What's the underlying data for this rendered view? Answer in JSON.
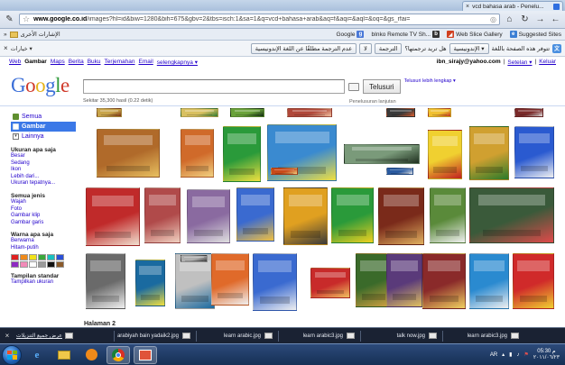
{
  "browser": {
    "tab_title": "vcd bahasa arab - Penelu...",
    "url_host": "www.google.co.id",
    "url_rest": "/images?hl=id&biw=1280&bih=675&gbv=2&tbs=isch:1&sa=1&q=vcd+bahasa+arab&aq=f&aqi=&aql=&oq=&gs_rfai=",
    "bookmarks_folder": "الإشارات الأخرى",
    "bookmarks": [
      "Google",
      "bInko Remote TV Sh...",
      "Web Slice Gallery",
      "Suggested Sites"
    ]
  },
  "translate_bar": {
    "options": "خيارات",
    "question": "هل تريد ترجمتها؟",
    "from_lang": "الإندونيسية",
    "prompt": "تتوفر هذه الصفحة باللغة",
    "translate_btn": "الترجمة",
    "close_btn": "لا",
    "never_btn": "عدم الترجمة مطلقًا عن اللغة الإندونيسية"
  },
  "gbar": {
    "links": [
      "Web",
      "Gambar",
      "Maps",
      "Berita",
      "Buku",
      "Terjemahan",
      "Email",
      "selengkapnya ▾"
    ],
    "active_index": 1,
    "user": "ibn_sirajy@yahoo.com",
    "settings": "Setelan ▾",
    "logout": "Keluar"
  },
  "search": {
    "logo": "Google",
    "button": "Telusuri",
    "advanced": "Telusuri lebih lengkap ▾",
    "preferences": "Penelusuran lanjutan",
    "stats": "Sekitar 35,300 hasil (0.22 detik)"
  },
  "sidebar": {
    "nav": [
      {
        "label": "Semua",
        "icon": "all-results-icon",
        "color": "#5f8f2f"
      },
      {
        "label": "Gambar",
        "icon": "images-icon",
        "color": "#ffffff"
      },
      {
        "label": "Lainnya",
        "icon": "more-icon",
        "color": "#777777"
      }
    ],
    "sections": [
      {
        "title": "Ukuran apa saja",
        "items": [
          "Besar",
          "Sedang",
          "Ikon",
          "Lebih dari...",
          "Ukuran tepatnya..."
        ]
      },
      {
        "title": "Semua jenis",
        "items": [
          "Wajah",
          "Foto",
          "Gambar klip",
          "Gambar garis"
        ]
      },
      {
        "title": "Warna apa saja",
        "items": [
          "Berwarna",
          "Hitam-putih"
        ]
      }
    ],
    "swatches": [
      "#e02020",
      "#f08a1a",
      "#f2e21a",
      "#3aa83a",
      "#19c0c0",
      "#2a4fd8",
      "#8e2ac2",
      "#f28ab8",
      "#ffffff",
      "#9a9a9a",
      "#111111",
      "#8a5a2a"
    ],
    "footer_title": "Tampilan standar",
    "footer_link": "Tampilkan ukuran"
  },
  "results": {
    "thumbs": [
      {
        "c1": "#c8a44a",
        "c2": "#7a3010"
      },
      {
        "c1": "#d8c060",
        "c2": "#2f7a30"
      },
      {
        "c1": "#6aa23a",
        "c2": "#102a10"
      },
      {
        "c1": "#b0483a",
        "c2": "#f0c0a0"
      },
      {
        "c1": "#3a3a3a",
        "c2": "#e06030"
      },
      {
        "c1": "#f0c030",
        "c2": "#c03020"
      },
      {
        "c1": "#7a2a2a",
        "c2": "#e0e0e0"
      },
      {
        "c1": "#b06a2a",
        "c2": "#e8c060"
      },
      {
        "c1": "#d06a2a",
        "c2": "#f0d080"
      },
      {
        "c1": "#2a9a3a",
        "c2": "#f0e040"
      },
      {
        "c1": "#3a8ad0",
        "c2": "#f0e040"
      },
      {
        "c1": "#7a9a7a",
        "c2": "#203020"
      },
      {
        "c1": "#f0d030",
        "c2": "#c02020"
      },
      {
        "c1": "#d0a030",
        "c2": "#2a7a2a"
      },
      {
        "c1": "#2a5ad0",
        "c2": "#f0f0f0"
      },
      {
        "c1": "#c02a2a",
        "c2": "#f0e0d0"
      },
      {
        "c1": "#b04a4a",
        "c2": "#f0d0c0"
      },
      {
        "c1": "#8a6aa0",
        "c2": "#e0e0e0"
      },
      {
        "c1": "#3a6ad0",
        "c2": "#f0c040"
      },
      {
        "c1": "#e0a020",
        "c2": "#3a3a3a"
      },
      {
        "c1": "#2a9a3a",
        "c2": "#f0d020"
      },
      {
        "c1": "#7a2a1a",
        "c2": "#e0b060"
      },
      {
        "c1": "#5a8a3a",
        "c2": "#f0f0f0"
      },
      {
        "c1": "#3a5a3a",
        "c2": "#e04a4a"
      },
      {
        "c1": "#6a6a6a",
        "c2": "#f0f0f0"
      },
      {
        "c1": "#1a6aa0",
        "c2": "#f0e040"
      },
      {
        "c1": "#c0c0c0",
        "c2": "#1a6aa0"
      },
      {
        "c1": "#e06a2a",
        "c2": "#f0f0f0"
      },
      {
        "c1": "#3a6ad0",
        "c2": "#f0f0f0"
      },
      {
        "c1": "#c82a2a",
        "c2": "#f0c060"
      },
      {
        "c1": "#3a6a2a",
        "c2": "#d0a040"
      },
      {
        "c1": "#5a3a7a",
        "c2": "#e0c060"
      },
      {
        "c1": "#8a2a2a",
        "c2": "#f0d060"
      },
      {
        "c1": "#2a8ad0",
        "c2": "#f0f0f0"
      },
      {
        "c1": "#d02a2a",
        "c2": "#f0d030"
      },
      {
        "c1": "#b0b0b0",
        "c2": "#3a3a3a"
      },
      {
        "c1": "#2a5aa0",
        "c2": "#e8e8e8"
      },
      {
        "c1": "#c84a1a",
        "c2": "#f0d080"
      },
      {
        "c1": "#e0e0e0",
        "c2": "#c02a2a"
      }
    ],
    "page_label": "Halaman 2"
  },
  "downloads": {
    "show_all": "عرض جميع التنزيلات",
    "files": [
      "arabiyah bain yadaik2.jpg",
      "learn arabic.jpg",
      "learn arabic3.jpg",
      "talk now.jpg",
      "learn arabic3.jpg"
    ]
  },
  "taskbar": {
    "apps": [
      "ie-icon",
      "explorer-icon",
      "media-player-icon",
      "chrome-icon",
      "paint-icon"
    ],
    "lang": "AR",
    "time": "05:30 م",
    "date": "٢٠١١/٠٦/٢٣"
  }
}
